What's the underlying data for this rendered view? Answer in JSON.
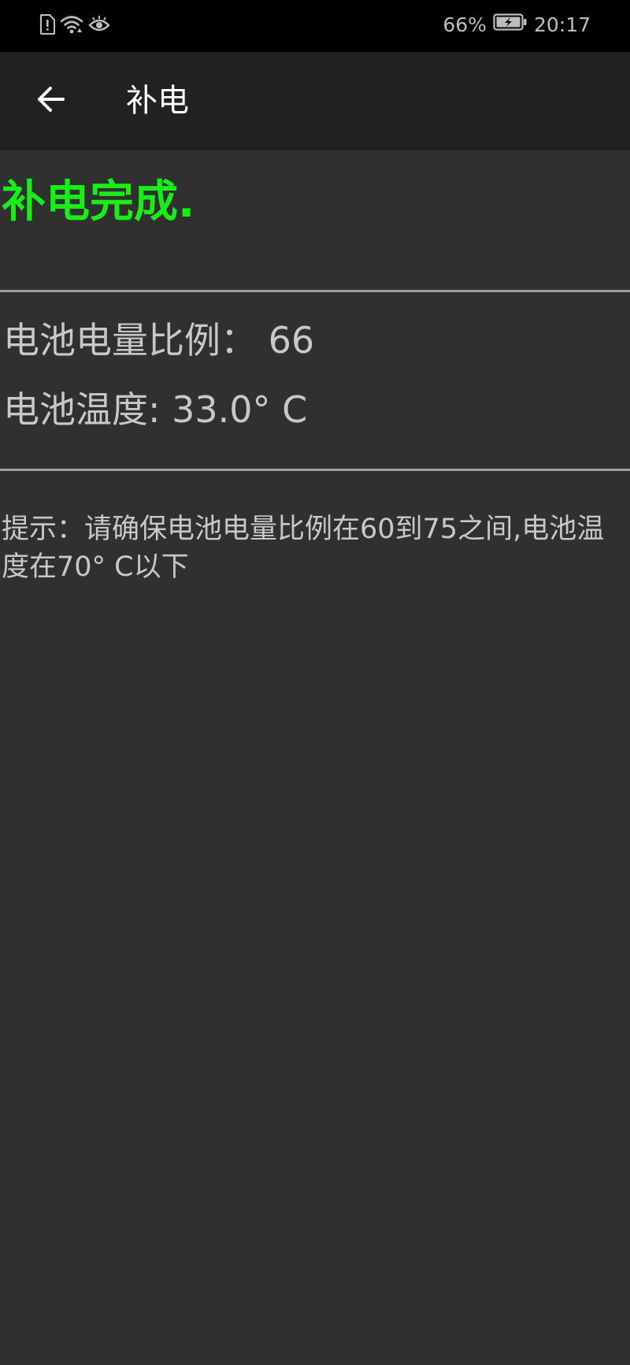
{
  "status_bar": {
    "battery_percent": "66%",
    "time": "20:17",
    "icons": [
      "sim-alert-icon",
      "wifi-icon",
      "eye-icon",
      "battery-charging-icon"
    ]
  },
  "app_bar": {
    "back_icon": "arrow-left-icon",
    "title": "补电"
  },
  "content": {
    "status_message": "补电完成.",
    "battery_level": "电池电量比例： 66",
    "battery_temperature": "电池温度: 33.0° C",
    "hint": "提示：请确保电池电量比例在60到75之间,电池温度在70° C以下"
  },
  "colors": {
    "status_bar_bg": "#000000",
    "app_bar_bg": "#212121",
    "content_bg": "#303030",
    "success_green": "#17ef17",
    "text_gray": "#c8c8c8",
    "divider": "#9e9e9e"
  }
}
